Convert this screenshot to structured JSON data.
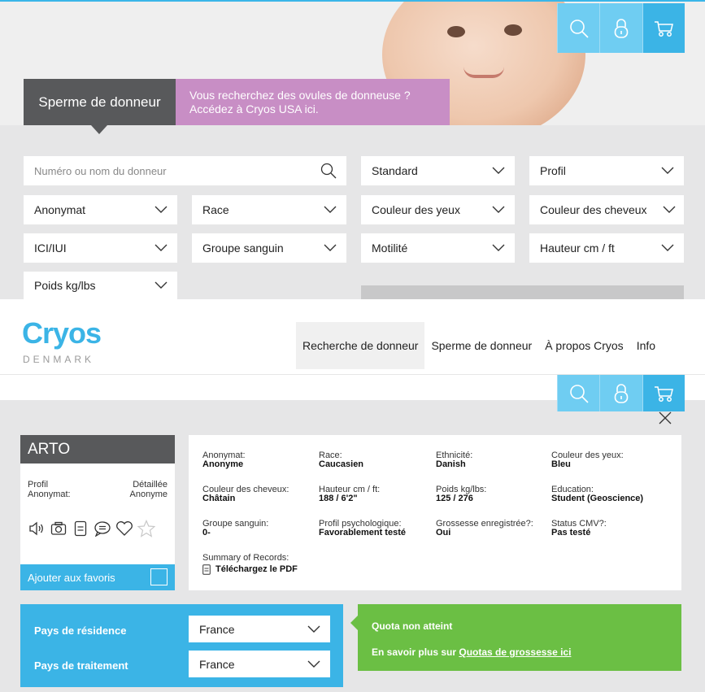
{
  "tabs": {
    "donor_sperm": "Sperme de donneur",
    "usa_line1": "Vous recherchez des ovules de donneuse ?",
    "usa_line2": "Accédez à Cryos USA ici."
  },
  "search": {
    "placeholder": "Numéro ou nom du donneur"
  },
  "filters": {
    "standard": "Standard",
    "profil": "Profil",
    "anonymat": "Anonymat",
    "race": "Race",
    "eye_color": "Couleur des yeux",
    "hair_color": "Couleur des cheveux",
    "ici_iui": "ICI/IUI",
    "blood_group": "Groupe sanguin",
    "motility": "Motilité",
    "height": "Hauteur cm / ft",
    "weight": "Poids kg/lbs"
  },
  "logo": {
    "word": "Cryos",
    "sub": "DENMARK"
  },
  "nav": [
    "Recherche de donneur",
    "Sperme de donneur",
    "À propos Cryos",
    "Info"
  ],
  "donor": {
    "name": "ARTO",
    "profil_label": "Profil",
    "profil_value": "Détaillée",
    "anonymat_label": "Anonymat:",
    "anonymat_value": "Anonyme",
    "favorite_label": "Ajouter aux favoris"
  },
  "details": [
    {
      "label": "Anonymat:",
      "value": "Anonyme"
    },
    {
      "label": "Race:",
      "value": "Caucasien"
    },
    {
      "label": "Ethnicité:",
      "value": "Danish"
    },
    {
      "label": "Couleur des yeux:",
      "value": "Bleu"
    },
    {
      "label": "Couleur des cheveux:",
      "value": "Châtain"
    },
    {
      "label": "Hauteur cm / ft:",
      "value": "188 / 6'2\""
    },
    {
      "label": "Poids kg/lbs:",
      "value": "125 / 276"
    },
    {
      "label": "Education:",
      "value": "Student (Geoscience)"
    },
    {
      "label": "Groupe sanguin:",
      "value": "0-"
    },
    {
      "label": "Profil psychologique:",
      "value": "Favorablement testé"
    },
    {
      "label": "Grossesse enregistrée?:",
      "value": "Oui"
    },
    {
      "label": "Status CMV?:",
      "value": "Pas testé"
    },
    {
      "label": "Summary of Records:",
      "value": "Téléchargez le PDF"
    }
  ],
  "country": {
    "residence_label": "Pays de résidence",
    "residence_value": "France",
    "treatment_label": "Pays de traitement",
    "treatment_value": "France"
  },
  "quota": {
    "status": "Quota non atteint",
    "more_prefix": "En savoir plus sur ",
    "more_link": "Quotas de grossesse ici"
  },
  "colors": {
    "accent": "#3bb4e6",
    "dark": "#58595b",
    "pink": "#c88ec5",
    "green": "#6bbf44"
  }
}
